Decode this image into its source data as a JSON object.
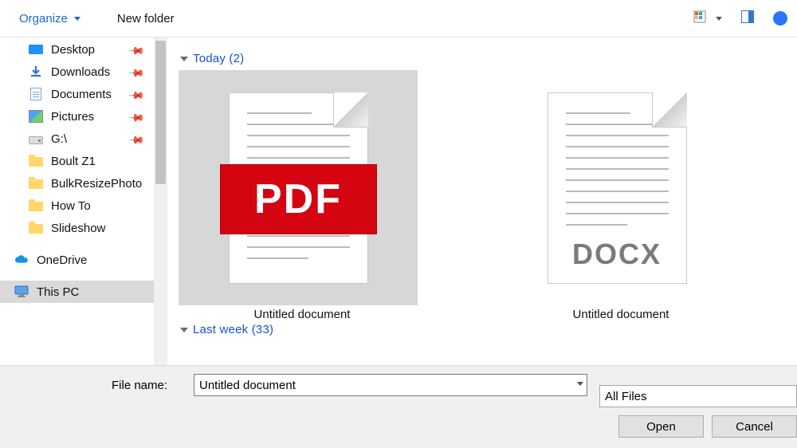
{
  "toolbar": {
    "organize_label": "Organize",
    "newfolder_label": "New folder"
  },
  "sidebar": {
    "items": [
      {
        "label": "Desktop",
        "pinned": true,
        "icon": "desktop"
      },
      {
        "label": "Downloads",
        "pinned": true,
        "icon": "downloads"
      },
      {
        "label": "Documents",
        "pinned": true,
        "icon": "documents"
      },
      {
        "label": "Pictures",
        "pinned": true,
        "icon": "pictures"
      },
      {
        "label": "G:\\",
        "pinned": true,
        "icon": "drive"
      },
      {
        "label": "Boult Z1",
        "pinned": false,
        "icon": "folder"
      },
      {
        "label": "BulkResizePhoto",
        "pinned": false,
        "icon": "folder"
      },
      {
        "label": "How To",
        "pinned": false,
        "icon": "folder"
      },
      {
        "label": "Slideshow",
        "pinned": false,
        "icon": "folder"
      }
    ],
    "onedrive_label": "OneDrive",
    "thispc_label": "This PC"
  },
  "groups": {
    "today_label": "Today (2)",
    "lastweek_label": "Last week (33)"
  },
  "files": {
    "pdf_caption": "Untitled document",
    "pdf_badge": "PDF",
    "docx_caption": "Untitled document",
    "docx_badge": "DOCX"
  },
  "bottom": {
    "filename_label": "File name:",
    "filename_value": "Untitled document",
    "filter_label": "All Files",
    "open_label": "Open",
    "cancel_label": "Cancel"
  }
}
